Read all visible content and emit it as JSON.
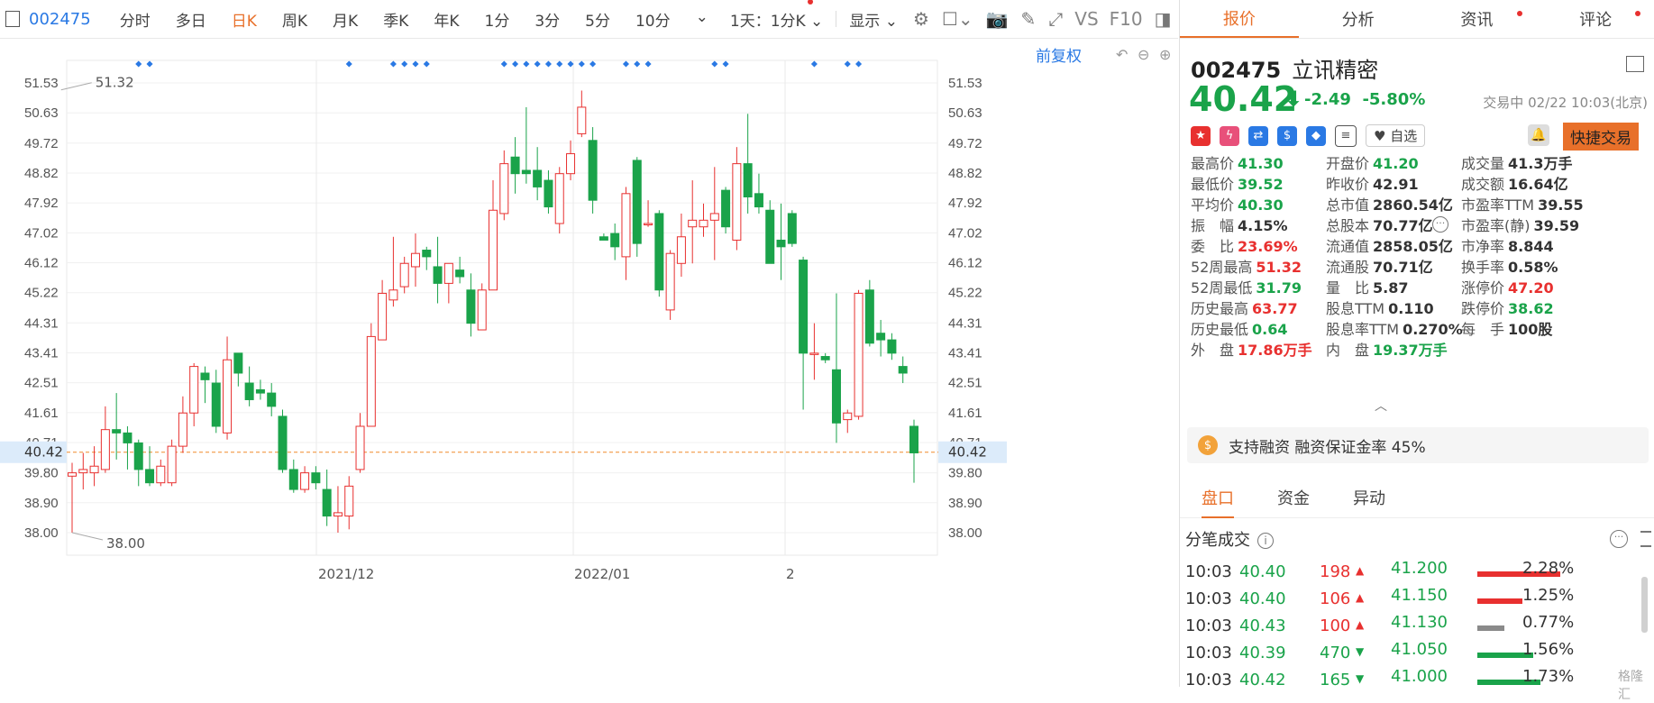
{
  "topbar": {
    "code": "002475",
    "periods": [
      "分时",
      "多日",
      "日K",
      "周K",
      "月K",
      "季K",
      "年K",
      "1分",
      "3分",
      "5分",
      "10分"
    ],
    "active_period": "日K",
    "interval_select": "1天：1分K",
    "display_label": "显示",
    "vs_label": "VS",
    "f10_label": "F10"
  },
  "chart": {
    "restore_label": "前复权",
    "current_price_label": "40.42",
    "date_labels": [
      "2021/12",
      "2022/01",
      "2"
    ],
    "high_marker": "51.32",
    "low_marker": "38.00"
  },
  "chart_data": {
    "type": "candlestick",
    "y_ticks": [
      51.53,
      50.63,
      49.72,
      48.82,
      47.92,
      47.02,
      46.12,
      45.22,
      44.31,
      43.41,
      42.51,
      41.61,
      40.71,
      39.8,
      38.9,
      38.0
    ],
    "y_tick_labels": [
      "51.53",
      "50.63",
      "49.72",
      "48.82",
      "47.92",
      "47.02",
      "46.12",
      "45.22",
      "44.31",
      "43.41",
      "42.51",
      "41.61",
      "40.71",
      "39.80",
      "38.90",
      "38.00"
    ],
    "ylim": [
      37.5,
      52.8
    ],
    "current_price": 40.42,
    "high": 51.32,
    "low": 38.0,
    "candles": [
      {
        "o": 39.7,
        "h": 40.1,
        "l": 38.0,
        "c": 39.8
      },
      {
        "o": 39.8,
        "h": 40.4,
        "l": 39.3,
        "c": 39.9
      },
      {
        "o": 39.8,
        "h": 40.6,
        "l": 39.4,
        "c": 40.0
      },
      {
        "o": 39.9,
        "h": 41.8,
        "l": 39.8,
        "c": 41.1
      },
      {
        "o": 41.1,
        "h": 42.2,
        "l": 40.2,
        "c": 41.0
      },
      {
        "o": 41.0,
        "h": 41.2,
        "l": 39.9,
        "c": 40.7
      },
      {
        "o": 40.7,
        "h": 40.8,
        "l": 39.4,
        "c": 39.9
      },
      {
        "o": 39.9,
        "h": 40.6,
        "l": 39.4,
        "c": 39.5
      },
      {
        "o": 39.5,
        "h": 40.2,
        "l": 39.4,
        "c": 40.0
      },
      {
        "o": 39.5,
        "h": 40.8,
        "l": 39.4,
        "c": 40.6
      },
      {
        "o": 40.6,
        "h": 42.1,
        "l": 40.4,
        "c": 41.6
      },
      {
        "o": 41.6,
        "h": 43.1,
        "l": 41.2,
        "c": 43.0
      },
      {
        "o": 42.8,
        "h": 43.0,
        "l": 41.9,
        "c": 42.6
      },
      {
        "o": 42.5,
        "h": 42.9,
        "l": 41.0,
        "c": 41.2
      },
      {
        "o": 41.0,
        "h": 43.9,
        "l": 40.8,
        "c": 43.2
      },
      {
        "o": 43.4,
        "h": 43.4,
        "l": 42.4,
        "c": 42.8
      },
      {
        "o": 42.5,
        "h": 43.0,
        "l": 41.8,
        "c": 42.0
      },
      {
        "o": 42.3,
        "h": 42.6,
        "l": 42.0,
        "c": 42.2
      },
      {
        "o": 42.2,
        "h": 42.5,
        "l": 41.5,
        "c": 41.8
      },
      {
        "o": 41.5,
        "h": 41.7,
        "l": 39.8,
        "c": 39.9
      },
      {
        "o": 39.9,
        "h": 40.2,
        "l": 39.2,
        "c": 39.3
      },
      {
        "o": 39.3,
        "h": 40.0,
        "l": 39.2,
        "c": 39.8
      },
      {
        "o": 39.8,
        "h": 40.0,
        "l": 39.3,
        "c": 39.5
      },
      {
        "o": 39.3,
        "h": 39.9,
        "l": 38.2,
        "c": 38.5
      },
      {
        "o": 38.5,
        "h": 39.4,
        "l": 38.0,
        "c": 38.6
      },
      {
        "o": 38.5,
        "h": 39.7,
        "l": 38.1,
        "c": 39.4
      },
      {
        "o": 39.9,
        "h": 41.6,
        "l": 39.8,
        "c": 41.2
      },
      {
        "o": 41.2,
        "h": 44.3,
        "l": 41.2,
        "c": 43.9
      },
      {
        "o": 43.8,
        "h": 45.6,
        "l": 43.8,
        "c": 45.2
      },
      {
        "o": 45.0,
        "h": 46.9,
        "l": 44.8,
        "c": 45.3
      },
      {
        "o": 45.4,
        "h": 46.3,
        "l": 45.2,
        "c": 46.1
      },
      {
        "o": 46.0,
        "h": 47.0,
        "l": 45.4,
        "c": 46.4
      },
      {
        "o": 46.5,
        "h": 46.6,
        "l": 45.9,
        "c": 46.3
      },
      {
        "o": 46.0,
        "h": 46.9,
        "l": 44.9,
        "c": 45.5
      },
      {
        "o": 45.5,
        "h": 46.1,
        "l": 44.9,
        "c": 46.1
      },
      {
        "o": 45.9,
        "h": 46.3,
        "l": 45.5,
        "c": 45.7
      },
      {
        "o": 45.3,
        "h": 45.8,
        "l": 43.9,
        "c": 44.3
      },
      {
        "o": 44.1,
        "h": 45.5,
        "l": 44.1,
        "c": 45.3
      },
      {
        "o": 45.3,
        "h": 48.6,
        "l": 45.3,
        "c": 47.7
      },
      {
        "o": 47.6,
        "h": 49.5,
        "l": 47.4,
        "c": 49.1
      },
      {
        "o": 49.3,
        "h": 49.9,
        "l": 48.2,
        "c": 48.8
      },
      {
        "o": 48.9,
        "h": 50.8,
        "l": 48.5,
        "c": 48.8
      },
      {
        "o": 48.9,
        "h": 49.6,
        "l": 48.0,
        "c": 48.4
      },
      {
        "o": 48.6,
        "h": 48.9,
        "l": 47.6,
        "c": 47.8
      },
      {
        "o": 47.3,
        "h": 49.0,
        "l": 47.0,
        "c": 48.8
      },
      {
        "o": 48.8,
        "h": 49.8,
        "l": 48.6,
        "c": 49.4
      },
      {
        "o": 50.0,
        "h": 51.3,
        "l": 49.9,
        "c": 50.8
      },
      {
        "o": 49.8,
        "h": 50.2,
        "l": 47.6,
        "c": 48.0
      },
      {
        "o": 46.9,
        "h": 47.0,
        "l": 46.8,
        "c": 46.8
      },
      {
        "o": 47.0,
        "h": 47.3,
        "l": 46.2,
        "c": 46.6
      },
      {
        "o": 46.3,
        "h": 48.4,
        "l": 45.6,
        "c": 48.2
      },
      {
        "o": 49.2,
        "h": 49.3,
        "l": 46.3,
        "c": 46.7
      },
      {
        "o": 47.3,
        "h": 48.0,
        "l": 47.2,
        "c": 47.3
      },
      {
        "o": 47.6,
        "h": 47.7,
        "l": 45.1,
        "c": 45.3
      },
      {
        "o": 44.7,
        "h": 46.5,
        "l": 44.4,
        "c": 46.4
      },
      {
        "o": 46.1,
        "h": 47.6,
        "l": 45.7,
        "c": 46.9
      },
      {
        "o": 47.2,
        "h": 48.6,
        "l": 46.1,
        "c": 47.4
      },
      {
        "o": 47.2,
        "h": 47.9,
        "l": 46.9,
        "c": 47.4
      },
      {
        "o": 47.4,
        "h": 49.0,
        "l": 46.2,
        "c": 47.6
      },
      {
        "o": 48.3,
        "h": 48.4,
        "l": 47.0,
        "c": 47.2
      },
      {
        "o": 46.8,
        "h": 49.6,
        "l": 46.5,
        "c": 49.1
      },
      {
        "o": 49.1,
        "h": 50.6,
        "l": 47.6,
        "c": 48.1
      },
      {
        "o": 48.2,
        "h": 48.8,
        "l": 47.6,
        "c": 47.8
      },
      {
        "o": 47.7,
        "h": 48.0,
        "l": 46.4,
        "c": 46.1
      },
      {
        "o": 46.8,
        "h": 47.9,
        "l": 45.6,
        "c": 46.6
      },
      {
        "o": 47.6,
        "h": 47.7,
        "l": 46.6,
        "c": 46.7
      },
      {
        "o": 46.2,
        "h": 46.3,
        "l": 41.7,
        "c": 43.4
      },
      {
        "o": 43.4,
        "h": 44.3,
        "l": 42.6,
        "c": 43.4
      },
      {
        "o": 43.3,
        "h": 43.4,
        "l": 43.1,
        "c": 43.2
      },
      {
        "o": 42.9,
        "h": 45.2,
        "l": 40.7,
        "c": 41.3
      },
      {
        "o": 41.4,
        "h": 41.7,
        "l": 41.0,
        "c": 41.6
      },
      {
        "o": 41.5,
        "h": 45.3,
        "l": 41.4,
        "c": 45.2
      },
      {
        "o": 45.3,
        "h": 45.6,
        "l": 43.6,
        "c": 43.7
      },
      {
        "o": 44.0,
        "h": 44.4,
        "l": 43.3,
        "c": 43.8
      },
      {
        "o": 43.8,
        "h": 44.0,
        "l": 43.2,
        "c": 43.4
      },
      {
        "o": 43.0,
        "h": 43.3,
        "l": 42.5,
        "c": 42.8
      },
      {
        "o": 41.2,
        "h": 41.4,
        "l": 39.5,
        "c": 40.4
      }
    ],
    "marker_indices": [
      6,
      7,
      25,
      29,
      30,
      31,
      32,
      39,
      40,
      41,
      42,
      43,
      44,
      45,
      46,
      47,
      50,
      51,
      52,
      58,
      59,
      67,
      70,
      71
    ]
  },
  "stock": {
    "code": "002475",
    "name": "立讯精密",
    "price": "40.42",
    "change": "-2.49",
    "change_pct": "-5.80%",
    "status": "交易中 02/22 10:03(北京)",
    "zixuan_label": "自选",
    "quick_trade_label": "快捷交易"
  },
  "tabs": [
    "报价",
    "分析",
    "资讯",
    "评论"
  ],
  "active_tab": "报价",
  "quote_fields": [
    [
      {
        "k": "最高价",
        "v": "41.30",
        "c": "g"
      },
      {
        "k": "开盘价",
        "v": "41.20",
        "c": "g"
      },
      {
        "k": "成交量",
        "v": "41.3万手",
        "c": ""
      }
    ],
    [
      {
        "k": "最低价",
        "v": "39.52",
        "c": "g"
      },
      {
        "k": "昨收价",
        "v": "42.91",
        "c": ""
      },
      {
        "k": "成交额",
        "v": "16.64亿",
        "c": ""
      }
    ],
    [
      {
        "k": "平均价",
        "v": "40.30",
        "c": "g"
      },
      {
        "k": "总市值",
        "v": "2860.54亿",
        "c": ""
      },
      {
        "k": "市盈率TTM",
        "v": "39.55",
        "c": ""
      }
    ],
    [
      {
        "k": "振　幅",
        "v": "4.15%",
        "c": ""
      },
      {
        "k": "总股本",
        "v": "70.77亿",
        "c": ""
      },
      {
        "k": "市盈率(静)",
        "v": "39.59",
        "c": ""
      }
    ],
    [
      {
        "k": "委　比",
        "v": "23.69%",
        "c": "r"
      },
      {
        "k": "流通值",
        "v": "2858.05亿",
        "c": ""
      },
      {
        "k": "市净率",
        "v": "8.844",
        "c": ""
      }
    ],
    [
      {
        "k": "52周最高",
        "v": "51.32",
        "c": "r"
      },
      {
        "k": "流通股",
        "v": "70.71亿",
        "c": ""
      },
      {
        "k": "换手率",
        "v": "0.58%",
        "c": ""
      }
    ],
    [
      {
        "k": "52周最低",
        "v": "31.79",
        "c": "g"
      },
      {
        "k": "量　比",
        "v": "5.87",
        "c": ""
      },
      {
        "k": "涨停价",
        "v": "47.20",
        "c": "r"
      }
    ],
    [
      {
        "k": "历史最高",
        "v": "63.77",
        "c": "r"
      },
      {
        "k": "股息TTM",
        "v": "0.110",
        "c": ""
      },
      {
        "k": "跌停价",
        "v": "38.62",
        "c": "g"
      }
    ],
    [
      {
        "k": "历史最低",
        "v": "0.64",
        "c": "g"
      },
      {
        "k": "股息率TTM",
        "v": "0.270%",
        "c": ""
      },
      {
        "k": "每　手",
        "v": "100股",
        "c": ""
      }
    ],
    [
      {
        "k": "外　盘",
        "v": "17.86万手",
        "c": "r"
      },
      {
        "k": "内　盘",
        "v": "19.37万手",
        "c": "g"
      },
      {
        "k": "",
        "v": "",
        "c": ""
      }
    ]
  ],
  "margin_text": "支持融资 融资保证金率 45%",
  "panel_tabs": [
    "盘口",
    "资金",
    "异动"
  ],
  "active_panel_tab": "盘口",
  "fenbi_label": "分笔成交",
  "trades": [
    {
      "time": "10:03",
      "price": "40.40",
      "vol": "198",
      "dir": "up",
      "lp": "41.200",
      "pct": "2.28%",
      "bar": "red",
      "barw": 92
    },
    {
      "time": "10:03",
      "price": "40.40",
      "vol": "106",
      "dir": "up",
      "lp": "41.150",
      "pct": "1.25%",
      "bar": "red",
      "barw": 50
    },
    {
      "time": "10:03",
      "price": "40.43",
      "vol": "100",
      "dir": "up",
      "lp": "41.130",
      "pct": "0.77%",
      "bar": "gray",
      "barw": 30
    },
    {
      "time": "10:03",
      "price": "40.39",
      "vol": "470",
      "dir": "down",
      "lp": "41.050",
      "pct": "1.56%",
      "bar": "green",
      "barw": 62
    },
    {
      "time": "10:03",
      "price": "40.42",
      "vol": "165",
      "dir": "down",
      "lp": "41.000",
      "pct": "1.73%",
      "bar": "green",
      "barw": 70
    }
  ],
  "watermark": "格隆汇",
  "colors": {
    "up": "#e8302f",
    "down": "#1aa34a",
    "accent": "#e8702a",
    "link": "#2a79e4"
  }
}
